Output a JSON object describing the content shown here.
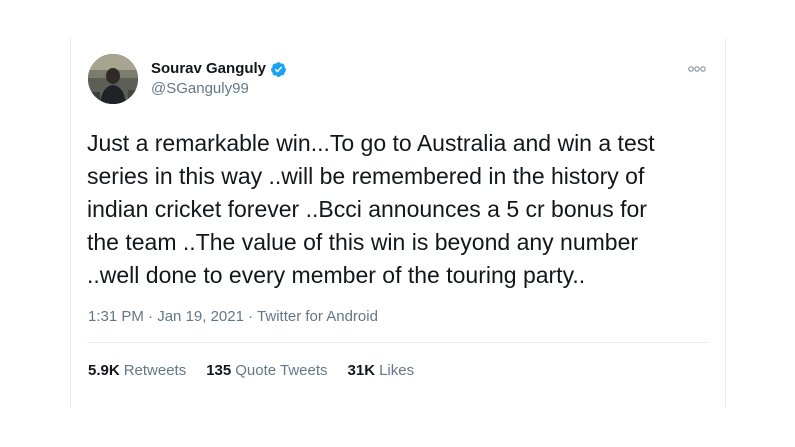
{
  "tweet": {
    "display_name": "Sourav Ganguly",
    "handle": "@SGanguly99",
    "verified": true,
    "more_icon": "more-dots-icon",
    "text": "Just a remarkable win...To go to Australia and win a test\nseries in this way ..will be remembered in the history of\nindian cricket forever ..Bcci announces a 5 cr bonus for\nthe team ..The value of this win is beyond any number\n..well done to every member of the touring party..",
    "time": "1:31 PM",
    "date": "Jan 19, 2021",
    "source": "Twitter for Android",
    "meta_separator": "·"
  },
  "stats": {
    "retweets_count": "5.9K",
    "retweets_label": "Retweets",
    "quote_count": "135",
    "quote_label": "Quote Tweets",
    "likes_count": "31K",
    "likes_label": "Likes"
  },
  "colors": {
    "text": "#14171a",
    "secondary": "#657786",
    "verified_blue": "#1da1f2",
    "border": "#e6ecf0"
  }
}
